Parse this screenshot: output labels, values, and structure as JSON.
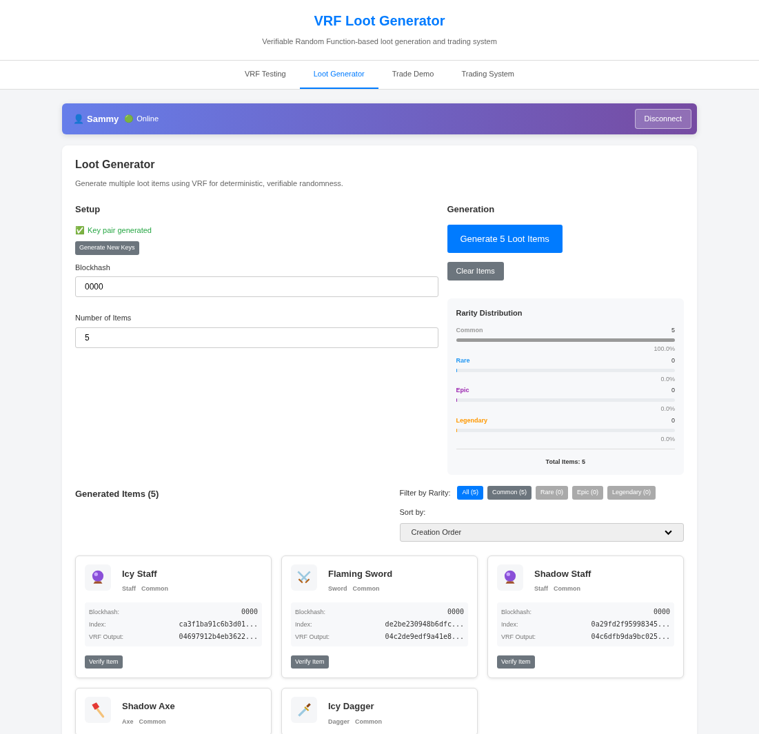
{
  "header": {
    "title": "VRF Loot Generator",
    "subtitle": "Verifiable Random Function-based loot generation and trading system"
  },
  "tabs": [
    {
      "label": "VRF Testing",
      "selected": false
    },
    {
      "label": "Loot Generator",
      "selected": true
    },
    {
      "label": "Trade Demo",
      "selected": false
    },
    {
      "label": "Trading System",
      "selected": false
    }
  ],
  "user_bar": {
    "user_icon": "👤",
    "username": "Sammy",
    "status_icon": "🟢",
    "status": "Online",
    "disconnect_button": "Disconnect"
  },
  "panel": {
    "title": "Loot Generator",
    "description": "Generate multiple loot items using VRF for deterministic, verifiable randomness."
  },
  "setup": {
    "heading": "Setup",
    "key_status_icon": "✅",
    "key_status": "Key pair generated",
    "new_keys_button": "Generate New Keys",
    "fields": [
      {
        "label": "Blockhash",
        "value": "0000"
      },
      {
        "label": "Number of Items",
        "value": "5"
      }
    ]
  },
  "generation": {
    "heading": "Generation",
    "generate_button": "Generate 5 Loot Items",
    "clear_button": "Clear Items"
  },
  "rarity_distribution": {
    "title": "Rarity Distribution",
    "total": "Total Items: 5",
    "rows": [
      {
        "name": "Common",
        "count": "5",
        "level": 1.0,
        "percent": "100.0%",
        "color": "#999999"
      },
      {
        "name": "Rare",
        "count": "0",
        "level": 0,
        "percent": "0.0%",
        "color": "#2196f3"
      },
      {
        "name": "Epic",
        "count": "0",
        "level": 0,
        "percent": "0.0%",
        "color": "#9c27b0"
      },
      {
        "name": "Legendary",
        "count": "0",
        "level": 0,
        "percent": "0.0%",
        "color": "#ff9800"
      }
    ]
  },
  "items_section": {
    "title": "Generated Items (5)",
    "filter_label": "Filter by Rarity:",
    "filters": [
      {
        "label": "All (5)",
        "selected": true,
        "disabled": false
      },
      {
        "label": "Common (5)",
        "selected": false,
        "disabled": false
      },
      {
        "label": "Rare (0)",
        "selected": false,
        "disabled": true
      },
      {
        "label": "Epic (0)",
        "selected": false,
        "disabled": true
      },
      {
        "label": "Legendary (0)",
        "selected": false,
        "disabled": true
      }
    ],
    "sort_label": "Sort by:",
    "sort_value": "Creation Order"
  },
  "items": [
    {
      "kind": "staff",
      "name": "Icy Staff",
      "type": "Staff",
      "rarity": "Common",
      "details": [
        {
          "label": "Blockhash:",
          "value": "0000"
        },
        {
          "label": "Index:",
          "value": "ca3f1ba91c6b3d01..."
        },
        {
          "label": "VRF Output:",
          "value": "04697912b4eb3622..."
        }
      ],
      "verify_button": "Verify Item"
    },
    {
      "kind": "sword",
      "name": "Flaming Sword",
      "type": "Sword",
      "rarity": "Common",
      "details": [
        {
          "label": "Blockhash:",
          "value": "0000"
        },
        {
          "label": "Index:",
          "value": "de2be230948b6dfc..."
        },
        {
          "label": "VRF Output:",
          "value": "04c2de9edf9a41e8..."
        }
      ],
      "verify_button": "Verify Item"
    },
    {
      "kind": "staff",
      "name": "Shadow Staff",
      "type": "Staff",
      "rarity": "Common",
      "details": [
        {
          "label": "Blockhash:",
          "value": "0000"
        },
        {
          "label": "Index:",
          "value": "0a29fd2f95998345..."
        },
        {
          "label": "VRF Output:",
          "value": "04c6dfb9da9bc025..."
        }
      ],
      "verify_button": "Verify Item"
    },
    {
      "kind": "axe",
      "name": "Shadow Axe",
      "type": "Axe",
      "rarity": "Common"
    },
    {
      "kind": "dagger",
      "name": "Icy Dagger",
      "type": "Dagger",
      "rarity": "Common"
    }
  ]
}
